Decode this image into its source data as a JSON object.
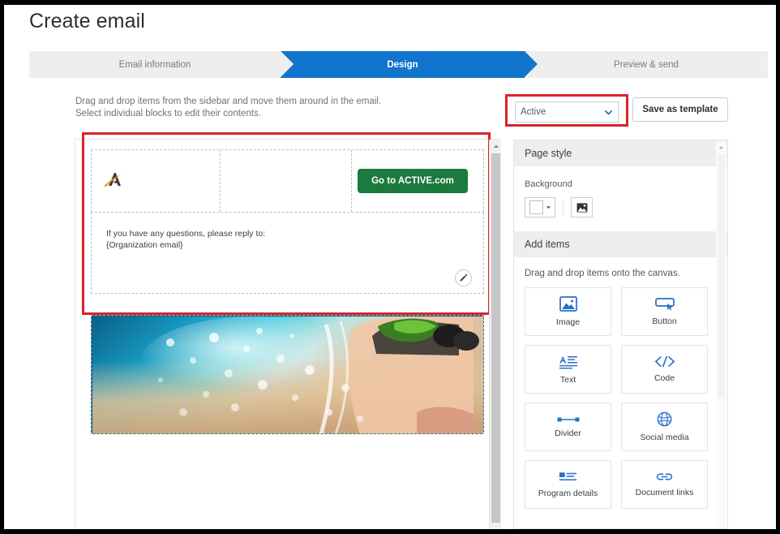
{
  "page": {
    "title": "Create email"
  },
  "steps": [
    {
      "label": "Email information",
      "state": "inactive"
    },
    {
      "label": "Design",
      "state": "active"
    },
    {
      "label": "Preview & send",
      "state": "inactive"
    }
  ],
  "instructions": {
    "line1": "Drag and drop items from the sidebar and move them around in the email.",
    "line2": "Select individual blocks to edit their contents."
  },
  "toolbar": {
    "status_value": "Active",
    "status_options": [
      "Active"
    ],
    "save_label": "Save as template"
  },
  "email_canvas": {
    "cta_label": "Go to ACTIVE.com",
    "logo_alt": "ACTIVE logo",
    "footer_line1": "If you have any questions, please reply to:",
    "footer_line2": "{Organization email}",
    "edit_tooltip": "Edit"
  },
  "sidebar": {
    "page_style": {
      "header": "Page style",
      "background_label": "Background",
      "background_color": "#ffffff"
    },
    "add_items": {
      "header": "Add items",
      "hint": "Drag and drop items onto the canvas.",
      "tiles": [
        {
          "label": "Image",
          "icon": "image-icon"
        },
        {
          "label": "Button",
          "icon": "button-icon"
        },
        {
          "label": "Text",
          "icon": "text-icon"
        },
        {
          "label": "Code",
          "icon": "code-icon"
        },
        {
          "label": "Divider",
          "icon": "divider-icon"
        },
        {
          "label": "Social media",
          "icon": "social-media-icon"
        },
        {
          "label": "Program details",
          "icon": "program-details-icon"
        },
        {
          "label": "Document links",
          "icon": "document-links-icon"
        }
      ]
    }
  },
  "colors": {
    "accent_blue": "#1275cd",
    "highlight_red": "#d9232d",
    "cta_green": "#1b7a3d",
    "icon_blue": "#2a6fc4"
  }
}
